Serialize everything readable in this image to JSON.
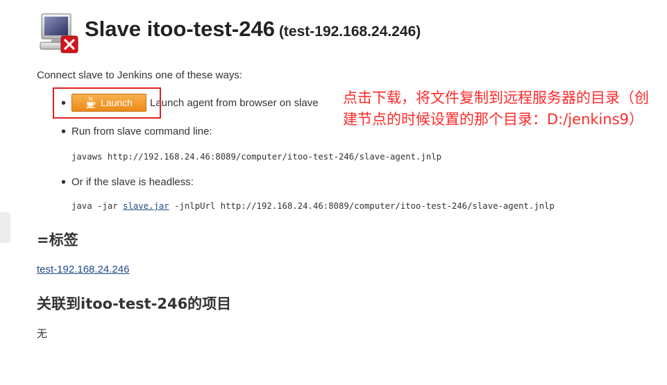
{
  "header": {
    "title": "Slave itoo-test-246",
    "subtitle": "(test-192.168.24.246)",
    "icon": "computer-offline-icon"
  },
  "connect": {
    "intro": "Connect slave to Jenkins one of these ways:",
    "launch_button_label": "Launch",
    "launch_button_icon": "java-cup-icon",
    "launch_description": "Launch agent from browser on slave",
    "command_line_label": "Run from slave command line:",
    "command_line_code": "javaws http://192.168.24.46:8089/computer/itoo-test-246/slave-agent.jnlp",
    "headless_label": "Or if the slave is headless:",
    "headless_code_prefix": "java -jar ",
    "headless_jar_link": "slave.jar",
    "headless_code_suffix": " -jnlpUrl http://192.168.24.46:8089/computer/itoo-test-246/slave-agent.jnlp"
  },
  "annotation": {
    "text": "点击下载，将文件复制到远程服务器的目录（创建节点的时候设置的那个目录：D:/jenkins9）",
    "color": "#ff2a2a"
  },
  "labels_section": {
    "title": "=标签",
    "link": "test-192.168.24.246"
  },
  "projects_section": {
    "title": "关联到itoo-test-246的项目",
    "empty_text": "无"
  },
  "colors": {
    "link": "#204a87",
    "launch_button": "#ec8a19",
    "highlight_box": "#e02020"
  }
}
